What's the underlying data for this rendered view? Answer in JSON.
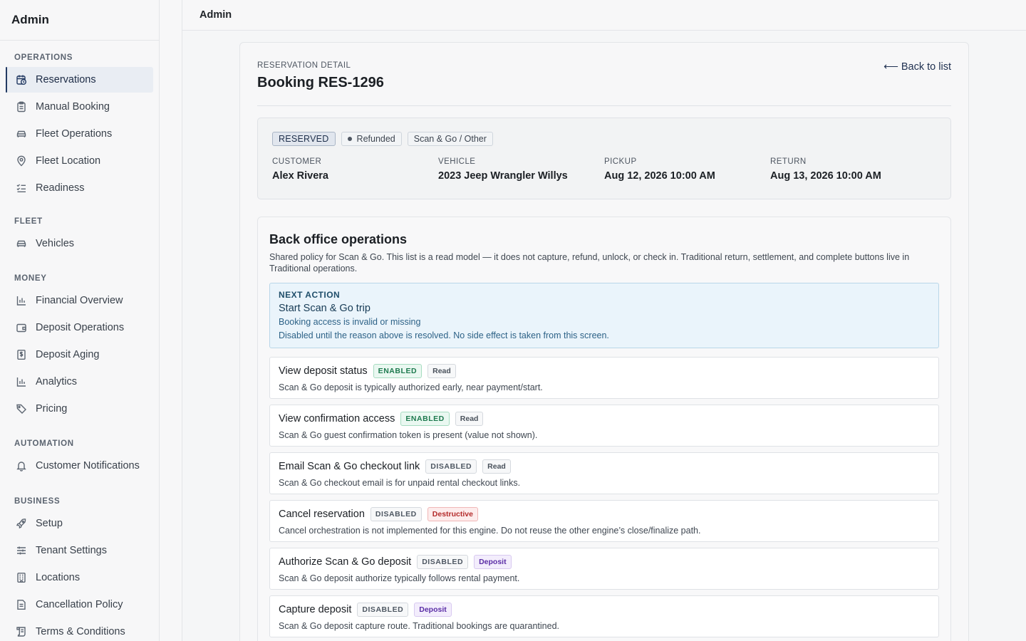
{
  "sidebar": {
    "brand": "Admin",
    "sections": [
      {
        "title": "OPERATIONS",
        "items": [
          {
            "label": "Reservations",
            "icon": "calendar-clock-icon",
            "active": true
          },
          {
            "label": "Manual Booking",
            "icon": "clipboard-icon"
          },
          {
            "label": "Fleet Operations",
            "icon": "car-icon"
          },
          {
            "label": "Fleet Location",
            "icon": "map-pin-icon"
          },
          {
            "label": "Readiness",
            "icon": "checklist-icon"
          }
        ]
      },
      {
        "title": "FLEET",
        "items": [
          {
            "label": "Vehicles",
            "icon": "car-icon"
          }
        ]
      },
      {
        "title": "MONEY",
        "items": [
          {
            "label": "Financial Overview",
            "icon": "bar-chart-icon"
          },
          {
            "label": "Deposit Operations",
            "icon": "wallet-icon"
          },
          {
            "label": "Deposit Aging",
            "icon": "dollar-receipt-icon"
          },
          {
            "label": "Analytics",
            "icon": "bar-chart-icon"
          },
          {
            "label": "Pricing",
            "icon": "tag-icon"
          }
        ]
      },
      {
        "title": "AUTOMATION",
        "items": [
          {
            "label": "Customer Notifications",
            "icon": "bell-icon"
          }
        ]
      },
      {
        "title": "BUSINESS",
        "items": [
          {
            "label": "Setup",
            "icon": "rocket-icon"
          },
          {
            "label": "Tenant Settings",
            "icon": "sliders-icon"
          },
          {
            "label": "Locations",
            "icon": "building-icon"
          },
          {
            "label": "Cancellation Policy",
            "icon": "document-icon"
          },
          {
            "label": "Terms & Conditions",
            "icon": "scroll-icon"
          }
        ]
      }
    ]
  },
  "topbar": {
    "title": "Admin"
  },
  "detail": {
    "eyebrow": "RESERVATION DETAIL",
    "title": "Booking RES-1296",
    "back_label": "⟵ Back to list"
  },
  "summary": {
    "badges": {
      "status": "RESERVED",
      "payment": "Refunded",
      "engine": "Scan & Go / Other"
    },
    "fields": [
      {
        "label": "CUSTOMER",
        "value": "Alex Rivera"
      },
      {
        "label": "VEHICLE",
        "value": "2023 Jeep Wrangler Willys"
      },
      {
        "label": "PICKUP",
        "value": "Aug 12, 2026 10:00 AM"
      },
      {
        "label": "RETURN",
        "value": "Aug 13, 2026 10:00 AM"
      }
    ]
  },
  "ops": {
    "title": "Back office operations",
    "description": "Shared policy for Scan & Go. This list is a read model — it does not capture, refund, unlock, or check in. Traditional return, settlement, and complete buttons live in Traditional operations.",
    "next_action": {
      "kicker": "NEXT ACTION",
      "title": "Start Scan & Go trip",
      "reason": "Booking access is invalid or missing",
      "note": "Disabled until the reason above is resolved. No side effect is taken from this screen."
    },
    "items": [
      {
        "name": "View deposit status",
        "status": "ENABLED",
        "kind": "Read",
        "description": "Scan & Go deposit is typically authorized early, near payment/start."
      },
      {
        "name": "View confirmation access",
        "status": "ENABLED",
        "kind": "Read",
        "description": "Scan & Go guest confirmation token is present (value not shown)."
      },
      {
        "name": "Email Scan & Go checkout link",
        "status": "DISABLED",
        "kind": "Read",
        "description": "Scan & Go checkout email is for unpaid rental checkout links."
      },
      {
        "name": "Cancel reservation",
        "status": "DISABLED",
        "kind": "Destructive",
        "description": "Cancel orchestration is not implemented for this engine. Do not reuse the other engine’s close/finalize path."
      },
      {
        "name": "Authorize Scan & Go deposit",
        "status": "DISABLED",
        "kind": "Deposit",
        "description": "Scan & Go deposit authorize typically follows rental payment."
      },
      {
        "name": "Capture deposit",
        "status": "DISABLED",
        "kind": "Deposit",
        "description": "Scan & Go deposit capture route. Traditional bookings are quarantined."
      }
    ]
  }
}
